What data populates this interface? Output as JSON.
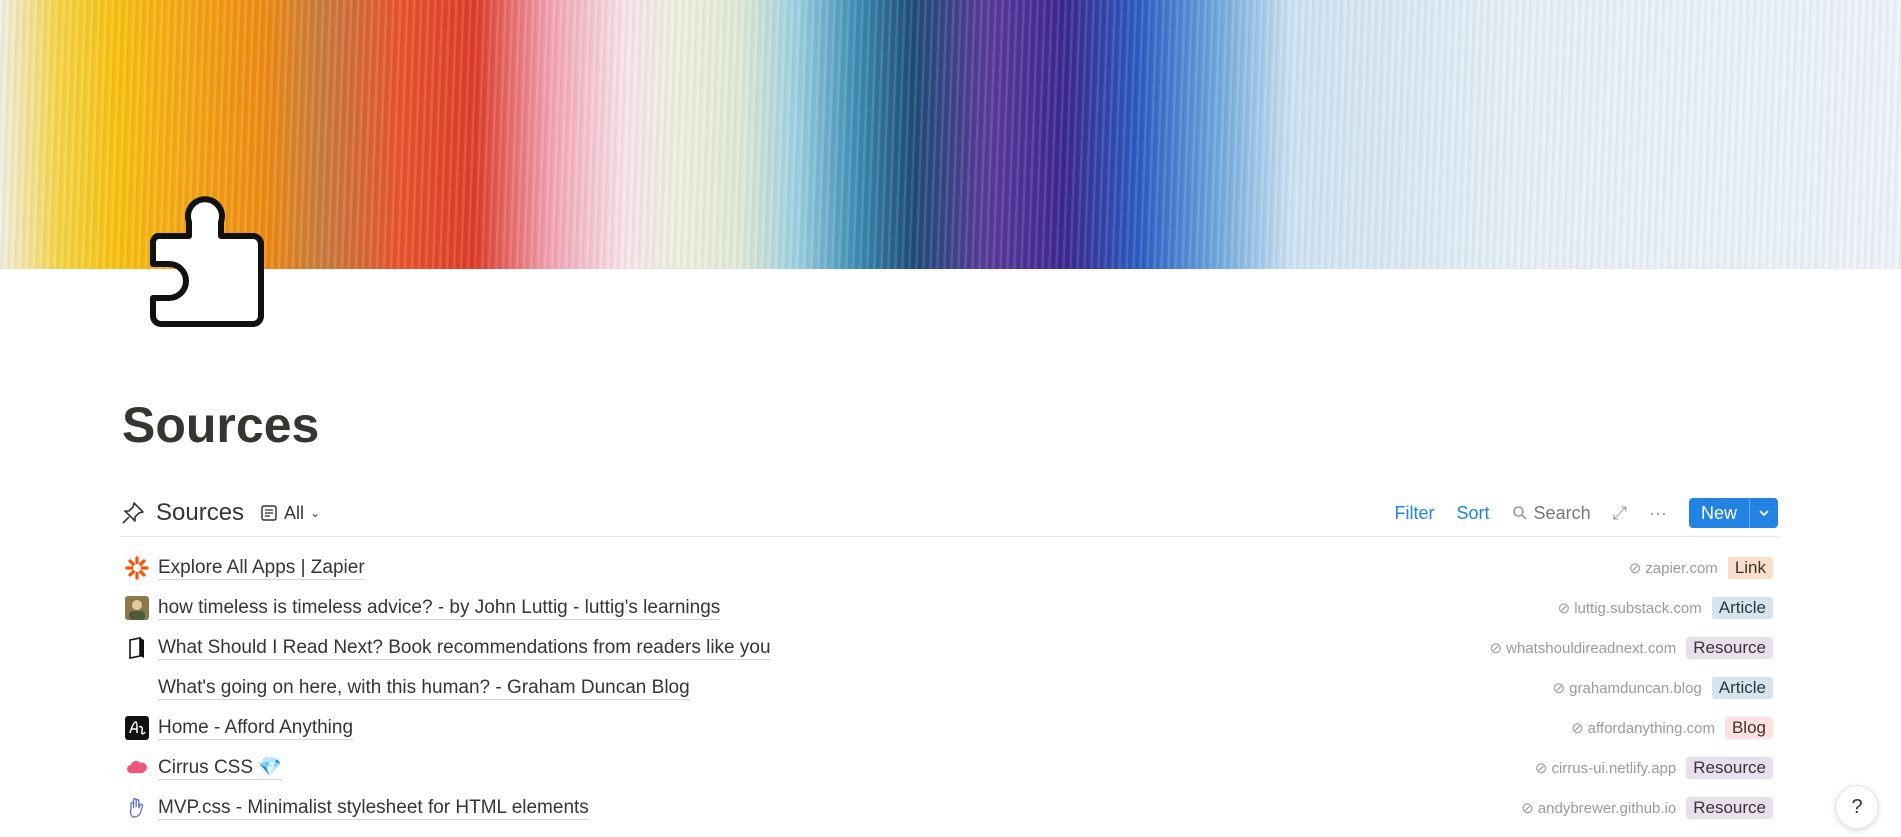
{
  "page": {
    "title": "Sources"
  },
  "database": {
    "title": "Sources",
    "view": {
      "label": "All"
    },
    "toolbar": {
      "filter": "Filter",
      "sort": "Sort",
      "search": "Search",
      "new_label": "New"
    }
  },
  "rows": [
    {
      "title": "Explore All Apps | Zapier",
      "url": "zapier.com",
      "tag": "Link",
      "icon": "zapier-icon"
    },
    {
      "title": "how timeless is timeless advice? - by John Luttig - luttig's learnings",
      "url": "luttig.substack.com",
      "tag": "Article",
      "icon": "avatar-icon"
    },
    {
      "title": "What Should I Read Next? Book recommendations from readers like you",
      "url": "whatshouldireadnext.com",
      "tag": "Resource",
      "icon": "book-icon"
    },
    {
      "title": "What's going on here, with this human? - Graham Duncan Blog",
      "url": "grahamduncan.blog",
      "tag": "Article",
      "icon": ""
    },
    {
      "title": "Home - Afford Anything",
      "url": "affordanything.com",
      "tag": "Blog",
      "icon": "afford-anything-icon"
    },
    {
      "title": "Cirrus CSS 💎",
      "url": "cirrus-ui.netlify.app",
      "tag": "Resource",
      "icon": "cloud-icon"
    },
    {
      "title": "MVP.css - Minimalist stylesheet for HTML elements",
      "url": "andybrewer.github.io",
      "tag": "Resource",
      "icon": "hand-icon"
    }
  ],
  "help": {
    "label": "?"
  }
}
